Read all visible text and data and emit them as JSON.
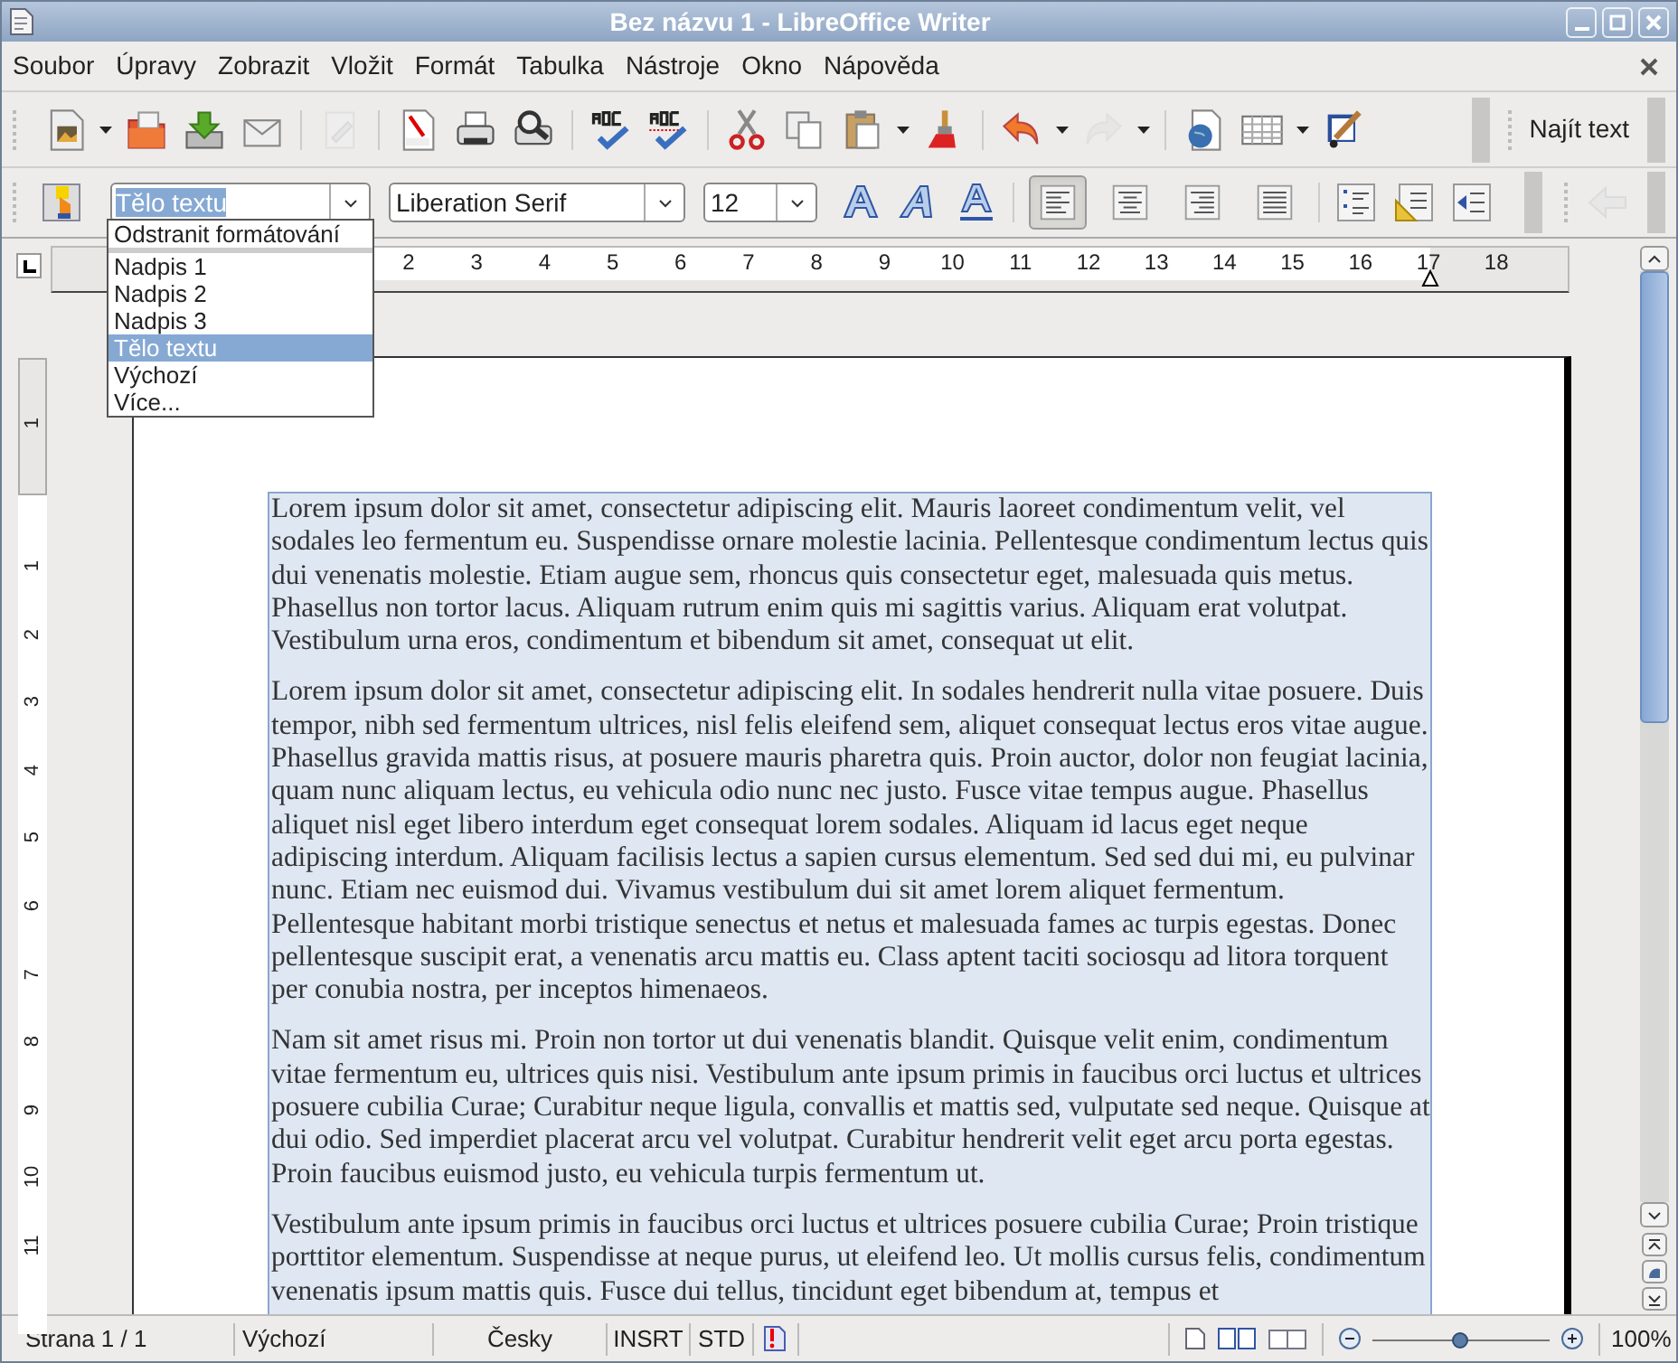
{
  "window": {
    "title": "Bez názvu 1 - LibreOffice Writer"
  },
  "menu": [
    {
      "label": "Soubor"
    },
    {
      "label": "Úpravy"
    },
    {
      "label": "Zobrazit"
    },
    {
      "label": "Vložit"
    },
    {
      "label": "Formát"
    },
    {
      "label": "Tabulka"
    },
    {
      "label": "Nástroje"
    },
    {
      "label": "Okno"
    },
    {
      "label": "Nápověda"
    }
  ],
  "standard_toolbar": [
    {
      "kind": "new",
      "dropdown": true,
      "disabled": false
    },
    {
      "kind": "open",
      "dropdown": false,
      "disabled": false
    },
    {
      "kind": "save",
      "dropdown": false,
      "disabled": false
    },
    {
      "kind": "mail",
      "dropdown": false,
      "disabled": false
    },
    {
      "kind": "sep"
    },
    {
      "kind": "edit",
      "dropdown": false,
      "disabled": true
    },
    {
      "kind": "sep"
    },
    {
      "kind": "pdf",
      "dropdown": false,
      "disabled": false
    },
    {
      "kind": "print",
      "dropdown": false,
      "disabled": false
    },
    {
      "kind": "preview",
      "dropdown": false,
      "disabled": false
    },
    {
      "kind": "sep"
    },
    {
      "kind": "spell",
      "dropdown": false,
      "disabled": false
    },
    {
      "kind": "autospell",
      "dropdown": false,
      "disabled": false
    },
    {
      "kind": "sep"
    },
    {
      "kind": "cut",
      "dropdown": false,
      "disabled": false
    },
    {
      "kind": "copy",
      "dropdown": false,
      "disabled": false
    },
    {
      "kind": "paste",
      "dropdown": true,
      "disabled": false
    },
    {
      "kind": "brush",
      "dropdown": false,
      "disabled": false
    },
    {
      "kind": "sep"
    },
    {
      "kind": "undo",
      "dropdown": true,
      "disabled": false
    },
    {
      "kind": "redo",
      "dropdown": true,
      "disabled": true
    },
    {
      "kind": "sep"
    },
    {
      "kind": "web",
      "dropdown": false,
      "disabled": false
    },
    {
      "kind": "table",
      "dropdown": true,
      "disabled": false
    },
    {
      "kind": "draw",
      "dropdown": false,
      "disabled": false
    }
  ],
  "find_toolbar": {
    "label": "Najít text"
  },
  "formatting_toolbar": {
    "style": "Tělo textu",
    "font": "Liberation Serif",
    "size": "12",
    "effects": [
      {
        "kind": "outline"
      },
      {
        "kind": "shadow"
      },
      {
        "kind": "underline-a"
      }
    ],
    "alignment": [
      {
        "kind": "left",
        "selected": true
      },
      {
        "kind": "center",
        "selected": false
      },
      {
        "kind": "right",
        "selected": false
      },
      {
        "kind": "justify",
        "selected": false
      }
    ],
    "lists": [
      {
        "kind": "numbering",
        "disabled": false
      },
      {
        "kind": "bullets",
        "disabled": false
      },
      {
        "kind": "outdent",
        "disabled": false
      },
      {
        "kind": "back",
        "disabled": true
      }
    ]
  },
  "style_dropdown": [
    {
      "label": "Odstranit formátování",
      "selected": false
    },
    {
      "label": "Nadpis 1",
      "selected": false
    },
    {
      "label": "Nadpis 2",
      "selected": false
    },
    {
      "label": "Nadpis 3",
      "selected": false
    },
    {
      "label": "Tělo textu",
      "selected": true
    },
    {
      "label": "Výchozí",
      "selected": false
    },
    {
      "label": "Více...",
      "selected": false
    }
  ],
  "horizontal_ruler": [
    "2",
    "3",
    "4",
    "5",
    "6",
    "7",
    "8",
    "9",
    "10",
    "11",
    "12",
    "13",
    "14",
    "15",
    "16",
    "17",
    "18"
  ],
  "vertical_ruler": [
    "1",
    "1",
    "2",
    "3",
    "4",
    "5",
    "6",
    "7",
    "8",
    "9",
    "10",
    "11"
  ],
  "document": {
    "paragraphs": [
      "Lorem ipsum dolor sit amet, consectetur adipiscing elit. Mauris laoreet condimentum velit, vel sodales leo fermentum eu. Suspendisse ornare molestie lacinia. Pellentesque condimentum lectus quis dui venenatis molestie. Etiam augue sem, rhoncus quis consectetur eget, malesuada quis metus. Phasellus non tortor lacus. Aliquam rutrum enim quis mi sagittis varius. Aliquam erat volutpat. Vestibulum urna eros, condimentum et bibendum sit amet, consequat ut elit.",
      "Lorem ipsum dolor sit amet, consectetur adipiscing elit. In sodales hendrerit nulla vitae posuere. Duis tempor, nibh sed fermentum ultrices, nisl felis eleifend sem, aliquet consequat lectus eros vitae augue. Phasellus gravida mattis risus, at posuere mauris pharetra quis. Proin auctor, dolor non feugiat lacinia, quam nunc aliquam lectus, eu vehicula odio nunc nec justo. Fusce vitae tempus augue. Phasellus aliquet nisl eget libero interdum eget consequat lorem sodales. Aliquam id lacus eget neque adipiscing interdum. Aliquam facilisis lectus a sapien cursus elementum. Sed sed dui mi, eu pulvinar nunc. Etiam nec euismod dui. Vivamus vestibulum dui sit amet lorem aliquet fermentum. Pellentesque habitant morbi tristique senectus et netus et malesuada fames ac turpis egestas. Donec pellentesque suscipit erat, a venenatis arcu mattis eu. Class aptent taciti sociosqu ad litora torquent per conubia nostra, per inceptos himenaeos.",
      "Nam sit amet risus mi. Proin non tortor ut dui venenatis blandit. Quisque velit enim, condimentum vitae fermentum eu, ultrices quis nisi. Vestibulum ante ipsum primis in faucibus orci luctus et ultrices posuere cubilia Curae; Curabitur neque ligula, convallis et mattis sed, vulputate sed neque. Quisque at dui odio. Sed imperdiet placerat arcu vel volutpat. Curabitur hendrerit velit eget arcu porta egestas. Proin faucibus euismod justo, eu vehicula turpis fermentum ut.",
      "Vestibulum ante ipsum primis in faucibus orci luctus et ultrices posuere cubilia Curae; Proin tristique porttitor elementum. Suspendisse at neque purus, ut eleifend leo. Ut mollis cursus felis, condimentum venenatis ipsum mattis quis. Fusce dui tellus, tincidunt eget bibendum at, tempus et"
    ]
  },
  "status_bar": {
    "page": "Strana 1 / 1",
    "page_style": "Výchozí",
    "language": "Česky",
    "insert_mode": "INSRT",
    "selection_mode": "STD",
    "zoom": {
      "level": 0.49,
      "label": "100%"
    }
  }
}
